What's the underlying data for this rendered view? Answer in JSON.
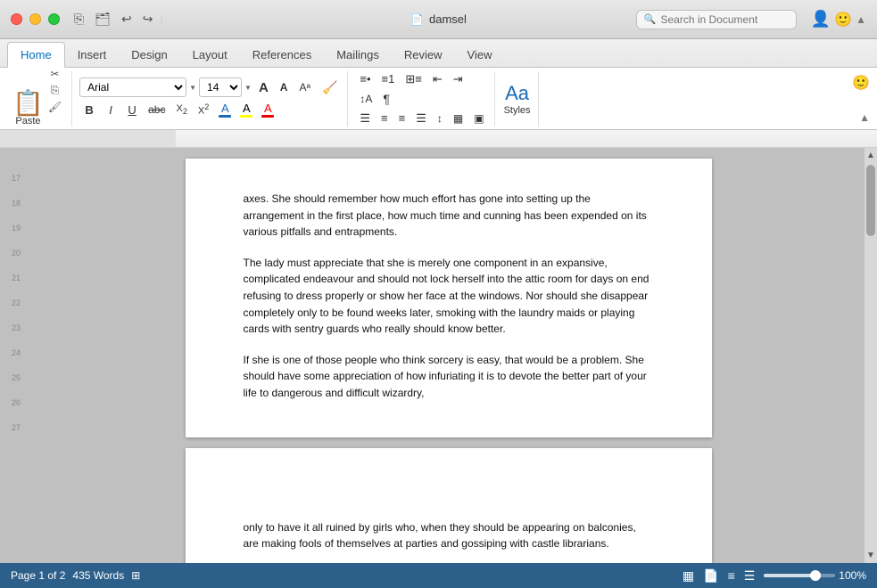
{
  "window": {
    "title": "damsel",
    "buttons": {
      "close": "close",
      "minimize": "minimize",
      "maximize": "maximize"
    }
  },
  "titlebar": {
    "doc_icon": "📄",
    "doc_title": "damsel",
    "search_placeholder": "Search in Document",
    "search_label": "Search Document"
  },
  "tabs": [
    {
      "id": "home",
      "label": "Home",
      "active": true
    },
    {
      "id": "insert",
      "label": "Insert",
      "active": false
    },
    {
      "id": "design",
      "label": "Design",
      "active": false
    },
    {
      "id": "layout",
      "label": "Layout",
      "active": false
    },
    {
      "id": "references",
      "label": "References",
      "active": false
    },
    {
      "id": "mailings",
      "label": "Mailings",
      "active": false
    },
    {
      "id": "review",
      "label": "Review",
      "active": false
    },
    {
      "id": "view",
      "label": "View",
      "active": false
    }
  ],
  "toolbar": {
    "paste_label": "Paste",
    "font_name": "Arial",
    "font_size": "14",
    "styles_label": "Styles",
    "bold": "B",
    "italic": "I",
    "underline": "U",
    "strikethrough": "abc",
    "subscript": "X₂",
    "superscript": "X²",
    "font_color_label": "A",
    "highlight_label": "A",
    "clear_format_label": "A"
  },
  "document": {
    "page1": {
      "paragraphs": [
        "axes. She should remember how much effort has gone into setting up the arrangement in the first place, how much time and cunning has been expended on its various pitfalls and entrapments.",
        "The lady must appreciate that she is merely one component in an expansive, complicated endeavour and should not lock herself into the attic room for days on end refusing to dress properly or show her face at the windows. Nor should she disappear completely only to be found weeks later, smoking with the laundry maids or playing cards with sentry guards who really should know better.",
        "If she is one of those people who think sorcery is easy, that would be a problem. She should have some appreciation of how infuriating it is to devote the better part of your life to dangerous and difficult wizardry,"
      ]
    },
    "page2": {
      "paragraphs": [
        "only to have it all ruined by girls who, when they should be appearing on balconies, are making fools of themselves at parties and gossiping with castle librarians."
      ]
    }
  },
  "statusbar": {
    "page_info": "Page 1 of 2",
    "word_count": "435 Words",
    "zoom_percent": "100%",
    "zoom_value": 72
  }
}
